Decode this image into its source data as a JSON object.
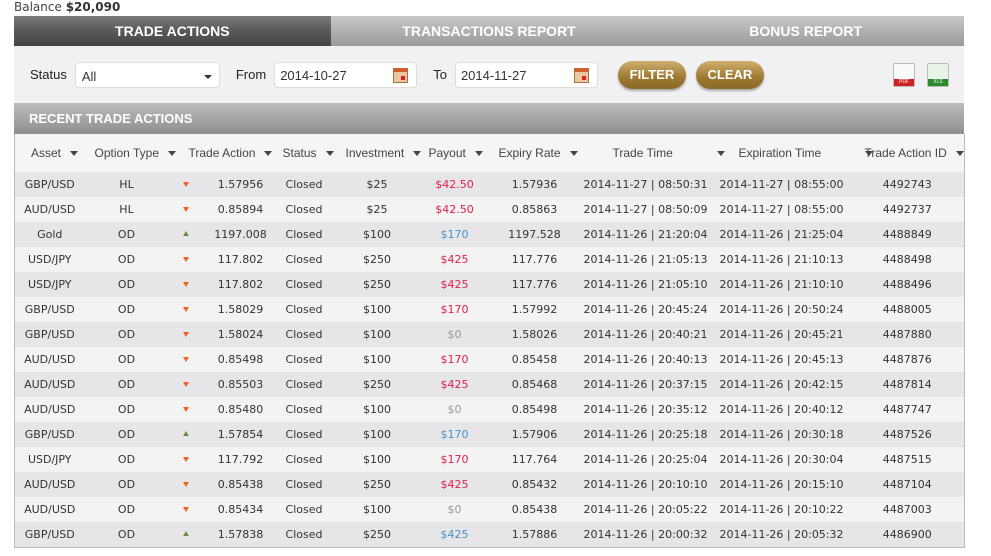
{
  "balance": {
    "label": "Balance",
    "value": "$20,090"
  },
  "tabs": [
    {
      "label": "TRADE ACTIONS"
    },
    {
      "label": "TRANSACTIONS REPORT"
    },
    {
      "label": "BONUS REPORT"
    }
  ],
  "filters": {
    "status_label": "Status",
    "status_value": "All",
    "from_label": "From",
    "from_value": "2014-10-27",
    "to_label": "To",
    "to_value": "2014-11-27",
    "filter_label": "FILTER",
    "clear_label": "CLEAR",
    "pdf_label": "PDF",
    "xls_label": "XLS"
  },
  "section_title": "RECENT TRADE ACTIONS",
  "columns": [
    "Asset",
    "Option Type",
    "Trade Action",
    "Status",
    "Investment",
    "Payout",
    "Expiry Rate",
    "Trade Time",
    "Expiration Time",
    "Trade Action ID"
  ],
  "payout_colors": {
    "loss": "#e0204a",
    "win": "#4a90c8",
    "zero": "#999999"
  },
  "rows": [
    [
      "GBP/USD",
      "HL",
      "down",
      "1.57956",
      "Closed",
      "$25",
      "$42.50",
      "loss",
      "1.57936",
      "2014-11-27 | 08:50:31",
      "2014-11-27 | 08:55:00",
      "4492743"
    ],
    [
      "AUD/USD",
      "HL",
      "down",
      "0.85894",
      "Closed",
      "$25",
      "$42.50",
      "loss",
      "0.85863",
      "2014-11-27 | 08:50:09",
      "2014-11-27 | 08:55:00",
      "4492737"
    ],
    [
      "Gold",
      "OD",
      "up",
      "1197.008",
      "Closed",
      "$100",
      "$170",
      "win",
      "1197.528",
      "2014-11-26 | 21:20:04",
      "2014-11-26 | 21:25:04",
      "4488849"
    ],
    [
      "USD/JPY",
      "OD",
      "down",
      "117.802",
      "Closed",
      "$250",
      "$425",
      "loss",
      "117.776",
      "2014-11-26 | 21:05:13",
      "2014-11-26 | 21:10:13",
      "4488498"
    ],
    [
      "USD/JPY",
      "OD",
      "down",
      "117.802",
      "Closed",
      "$250",
      "$425",
      "loss",
      "117.776",
      "2014-11-26 | 21:05:10",
      "2014-11-26 | 21:10:10",
      "4488496"
    ],
    [
      "GBP/USD",
      "OD",
      "down",
      "1.58029",
      "Closed",
      "$100",
      "$170",
      "loss",
      "1.57992",
      "2014-11-26 | 20:45:24",
      "2014-11-26 | 20:50:24",
      "4488005"
    ],
    [
      "GBP/USD",
      "OD",
      "down",
      "1.58024",
      "Closed",
      "$100",
      "$0",
      "zero",
      "1.58026",
      "2014-11-26 | 20:40:21",
      "2014-11-26 | 20:45:21",
      "4487880"
    ],
    [
      "AUD/USD",
      "OD",
      "down",
      "0.85498",
      "Closed",
      "$100",
      "$170",
      "loss",
      "0.85458",
      "2014-11-26 | 20:40:13",
      "2014-11-26 | 20:45:13",
      "4487876"
    ],
    [
      "AUD/USD",
      "OD",
      "down",
      "0.85503",
      "Closed",
      "$250",
      "$425",
      "loss",
      "0.85468",
      "2014-11-26 | 20:37:15",
      "2014-11-26 | 20:42:15",
      "4487814"
    ],
    [
      "AUD/USD",
      "OD",
      "down",
      "0.85480",
      "Closed",
      "$100",
      "$0",
      "zero",
      "0.85498",
      "2014-11-26 | 20:35:12",
      "2014-11-26 | 20:40:12",
      "4487747"
    ],
    [
      "GBP/USD",
      "OD",
      "up",
      "1.57854",
      "Closed",
      "$100",
      "$170",
      "win",
      "1.57906",
      "2014-11-26 | 20:25:18",
      "2014-11-26 | 20:30:18",
      "4487526"
    ],
    [
      "USD/JPY",
      "OD",
      "down",
      "117.792",
      "Closed",
      "$100",
      "$170",
      "loss",
      "117.764",
      "2014-11-26 | 20:25:04",
      "2014-11-26 | 20:30:04",
      "4487515"
    ],
    [
      "AUD/USD",
      "OD",
      "down",
      "0.85438",
      "Closed",
      "$250",
      "$425",
      "loss",
      "0.85432",
      "2014-11-26 | 20:10:10",
      "2014-11-26 | 20:15:10",
      "4487104"
    ],
    [
      "AUD/USD",
      "OD",
      "down",
      "0.85434",
      "Closed",
      "$100",
      "$0",
      "zero",
      "0.85438",
      "2014-11-26 | 20:05:22",
      "2014-11-26 | 20:10:22",
      "4487003"
    ],
    [
      "GBP/USD",
      "OD",
      "up",
      "1.57838",
      "Closed",
      "$250",
      "$425",
      "win",
      "1.57886",
      "2014-11-26 | 20:00:32",
      "2014-11-26 | 20:05:32",
      "4486900"
    ]
  ]
}
